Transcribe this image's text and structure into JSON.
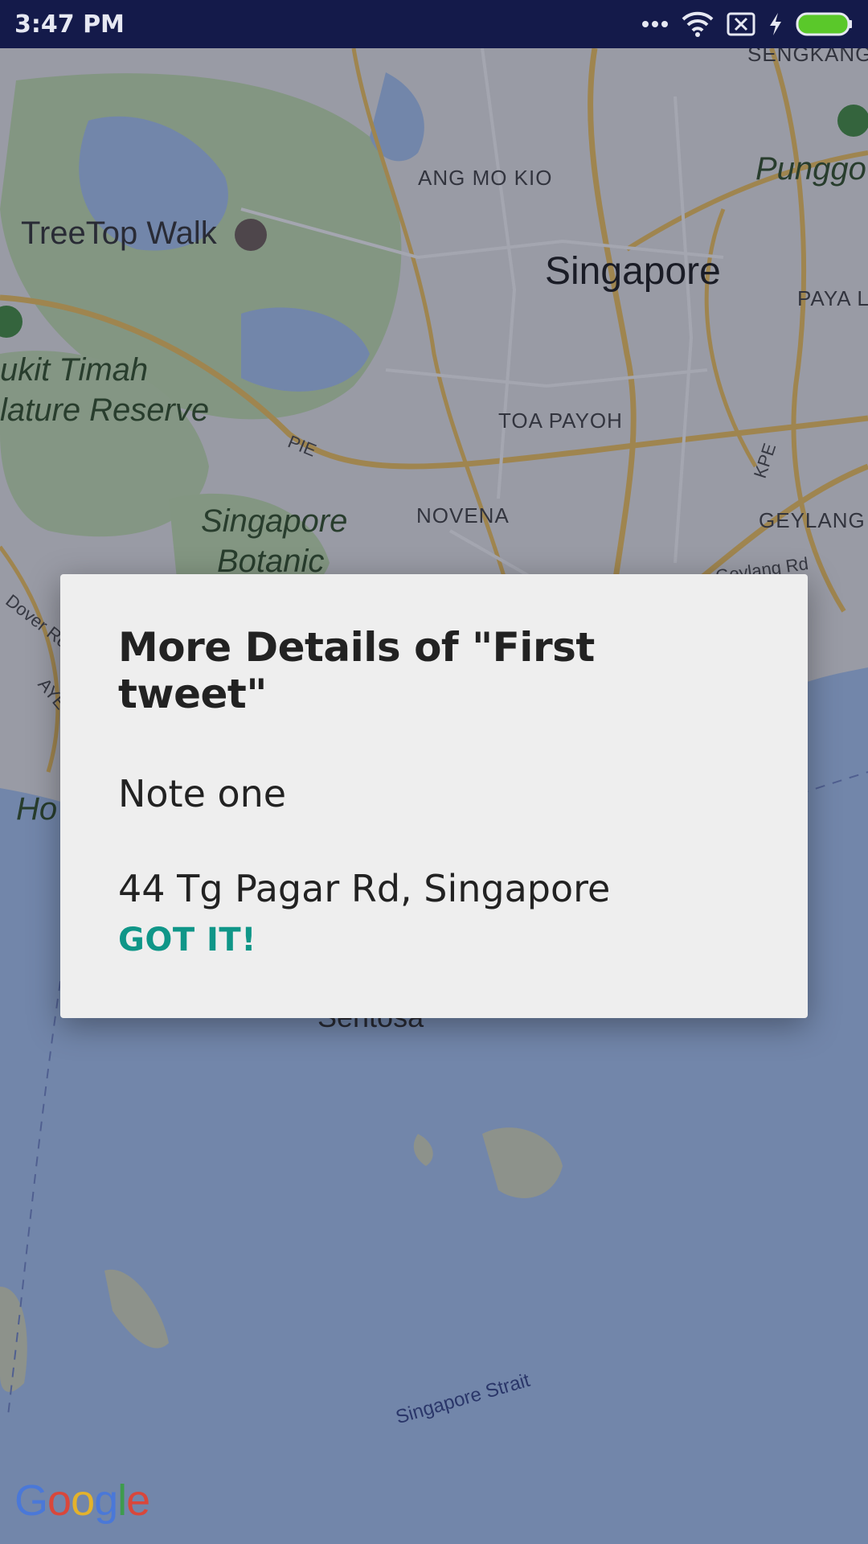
{
  "status_bar": {
    "time": "3:47 PM",
    "icons": [
      "more-dots-icon",
      "wifi-icon",
      "sim-none-icon",
      "charging-bolt-icon",
      "battery-icon"
    ],
    "battery_color": "#5ac82a"
  },
  "map": {
    "labels": {
      "sengkang": "SENGKANG",
      "punggol": "Punggo",
      "ang_mo_kio": "ANG MO KIO",
      "treetop_walk": "TreeTop Walk",
      "singapore": "Singapore",
      "paya_lebar": "PAYA L",
      "bukit_timah_1": "ukit Timah",
      "bukit_timah_2": "lature Reserve",
      "toa_payoh": "TOA PAYOH",
      "pie": "PIE",
      "kpe": "KPE",
      "novena": "NOVENA",
      "geylang": "GEYLANG",
      "botanic_1": "Singapore",
      "botanic_2": "Botanic",
      "geylang_rd": "Geylang Rd",
      "dover_rd": "Dover Rd",
      "aye": "AYE",
      "ho": "Ho",
      "sentosa": "Sentosa",
      "singapore_strait": "Singapore Strait"
    },
    "attribution": "Google",
    "colors": {
      "land": "#ececec",
      "water": "#a9c8f5",
      "park": "#c6e3b0",
      "road": "#f6c659"
    }
  },
  "dialog": {
    "title": "More Details of \"First tweet\"",
    "note": "Note one",
    "address": "44 Tg Pagar Rd, Singapore",
    "button_label": "GOT IT!",
    "button_color": "#0f9688"
  }
}
